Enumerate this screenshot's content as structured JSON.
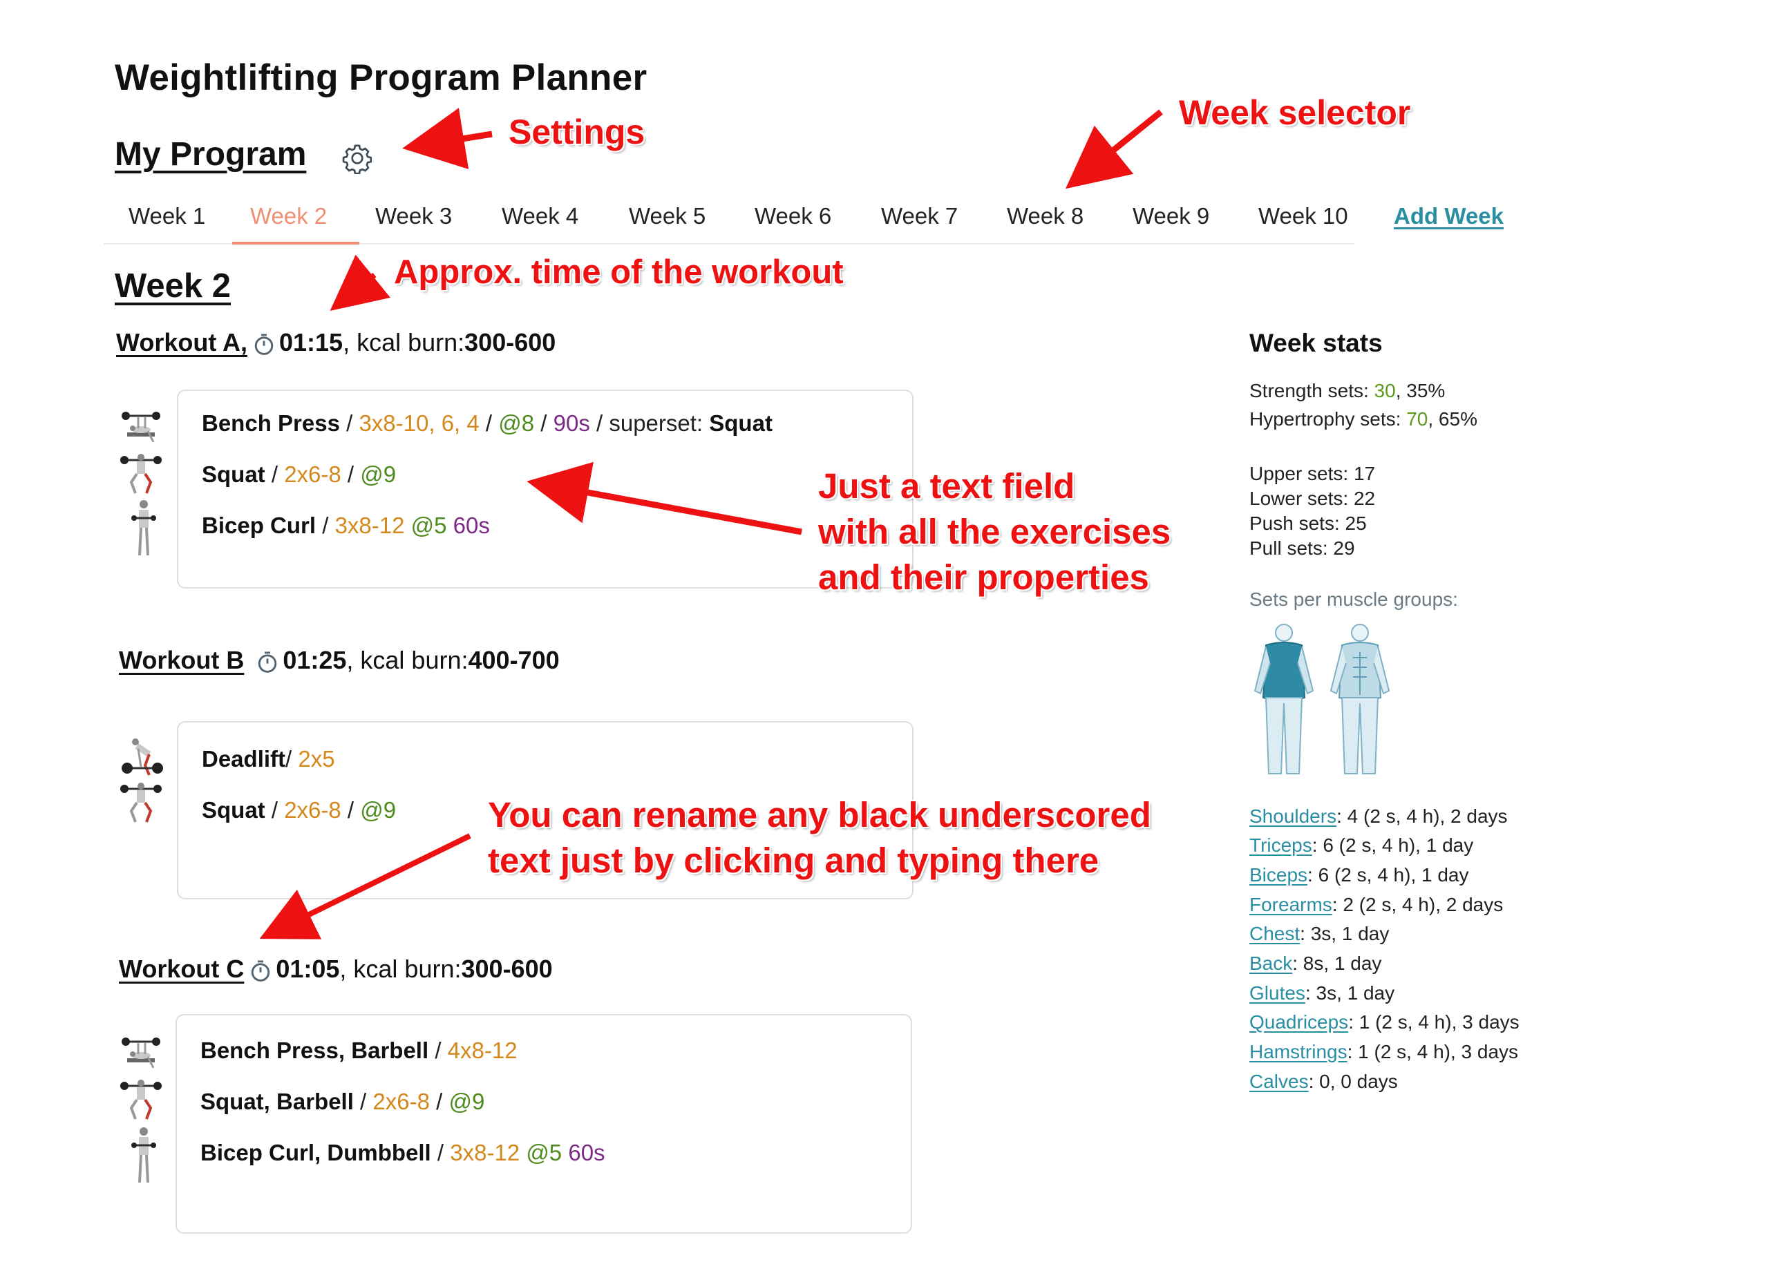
{
  "app": {
    "title": "Weightlifting Program Planner"
  },
  "program": {
    "title": "My Program",
    "settings_icon": "gear-icon"
  },
  "weeks": {
    "tabs": [
      "Week 1",
      "Week 2",
      "Week 3",
      "Week 4",
      "Week 5",
      "Week 6",
      "Week 7",
      "Week 8",
      "Week 9",
      "Week 10"
    ],
    "active": "Week 2",
    "add_label": "Add Week"
  },
  "week": {
    "title": "Week 2"
  },
  "workouts": [
    {
      "name": "Workout A,",
      "time": "01:15",
      "kcal_label": ", kcal burn: ",
      "kcal": "300-600",
      "exercises": [
        {
          "name": "Bench Press",
          "sep1": " / ",
          "sets": "3x8-10, 6, 4",
          "sep2": " / ",
          "rpe": "@8",
          "sep3": " / ",
          "rest": "90s",
          "sep4": " / superset: ",
          "superset": "Squat"
        },
        {
          "name": "Squat",
          "sep1": " / ",
          "sets": "2x6-8",
          "sep2": " / ",
          "rpe": "@9"
        },
        {
          "name": "Bicep Curl",
          "sep1": " / ",
          "sets": "3x8-12 ",
          "rpe": "@5 ",
          "rest": "60s"
        }
      ]
    },
    {
      "name": "Workout B",
      "time": "01:25",
      "kcal_label": ", kcal burn: ",
      "kcal": "400-700",
      "exercises": [
        {
          "name": "Deadlift",
          "sep1": "/ ",
          "sets": "2x5"
        },
        {
          "name": "Squat",
          "sep1": " / ",
          "sets": "2x6-8",
          "sep2": " / ",
          "rpe": "@9"
        }
      ]
    },
    {
      "name": "Workout C",
      "time": "01:05",
      "kcal_label": ", kcal burn: ",
      "kcal": "300-600",
      "exercises": [
        {
          "name": "Bench Press, Barbell",
          "sep1": " / ",
          "sets": "4x8-12"
        },
        {
          "name": "Squat, Barbell",
          "sep1": " / ",
          "sets": "2x6-8",
          "sep2": " / ",
          "rpe": "@9"
        },
        {
          "name": "Bicep Curl, Dumbbell",
          "sep1": " / ",
          "sets": "3x8-12 ",
          "rpe": "@5 ",
          "rest": "60s"
        }
      ]
    }
  ],
  "stats": {
    "title": "Week stats",
    "strength": {
      "label": "Strength sets: ",
      "value": "30",
      "pct": ", 35%"
    },
    "hypertrophy": {
      "label": "Hypertrophy sets: ",
      "value": "70",
      "pct": ", 65%"
    },
    "split": [
      "Upper sets: 17",
      "Lower sets: 22",
      "Push sets: 25",
      "Pull sets: 29"
    ],
    "muscle_groups_label": "Sets per muscle groups:",
    "muscles": [
      {
        "name": "Shoulders",
        "detail": ": 4 (2 s, 4 h), 2 days"
      },
      {
        "name": "Triceps",
        "detail": ": 6 (2 s, 4 h), 1 day"
      },
      {
        "name": "Biceps",
        "detail": ": 6 (2 s, 4 h), 1 day"
      },
      {
        "name": "Forearms",
        "detail": ": 2 (2 s, 4 h), 2 days"
      },
      {
        "name": "Chest",
        "detail": ": 3s, 1 day"
      },
      {
        "name": "Back",
        "detail": ": 8s, 1 day"
      },
      {
        "name": "Glutes",
        "detail": ": 3s, 1 day"
      },
      {
        "name": "Quadriceps",
        "detail": ": 1 (2 s, 4 h), 3 days"
      },
      {
        "name": "Hamstrings",
        "detail": ": 1 (2 s, 4 h), 3 days"
      },
      {
        "name": "Calves",
        "detail": ":  0, 0 days"
      }
    ]
  },
  "annotations": {
    "settings": "Settings",
    "week_selector": "Week selector",
    "time": "Approx. time of the workout",
    "text_field": [
      "Just a text field",
      "with all the exercises",
      "and their properties"
    ],
    "rename": [
      "You can rename any black underscored",
      "text just by clicking and typing there"
    ]
  },
  "colors": {
    "active_tab": "#f08e72",
    "link": "#2a8ea3",
    "sets": "#d4881c",
    "rpe": "#4e8a1e",
    "rest": "#7c2a86",
    "annotation": "#ee1111"
  }
}
